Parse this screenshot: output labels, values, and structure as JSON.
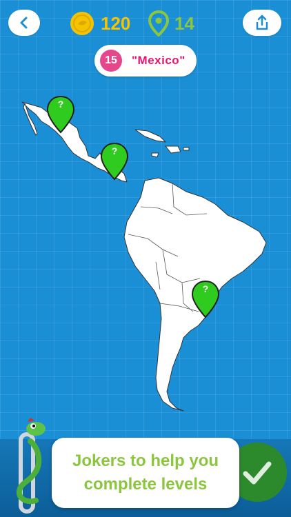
{
  "header": {
    "coins": "120",
    "locations": "14"
  },
  "level": {
    "number": "15",
    "country": "\"Mexico\""
  },
  "pins": [
    {
      "label": "?"
    },
    {
      "label": "?"
    },
    {
      "label": "?"
    }
  ],
  "tooltip": {
    "line1": "Jokers to help you",
    "line2": "complete levels"
  },
  "colors": {
    "background": "#1a8fd6",
    "coin": "#f5c400",
    "location": "#8cc63e",
    "level_badge": "#e6468c",
    "level_text": "#e6166e",
    "pin_green": "#2fcc1f",
    "tooltip_text": "#8cc63e",
    "check_button": "#2c8a2c"
  },
  "icons": {
    "back": "chevron-left-icon",
    "coin": "coin-icon",
    "location": "location-pin-icon",
    "share": "share-icon",
    "check": "checkmark-icon"
  }
}
